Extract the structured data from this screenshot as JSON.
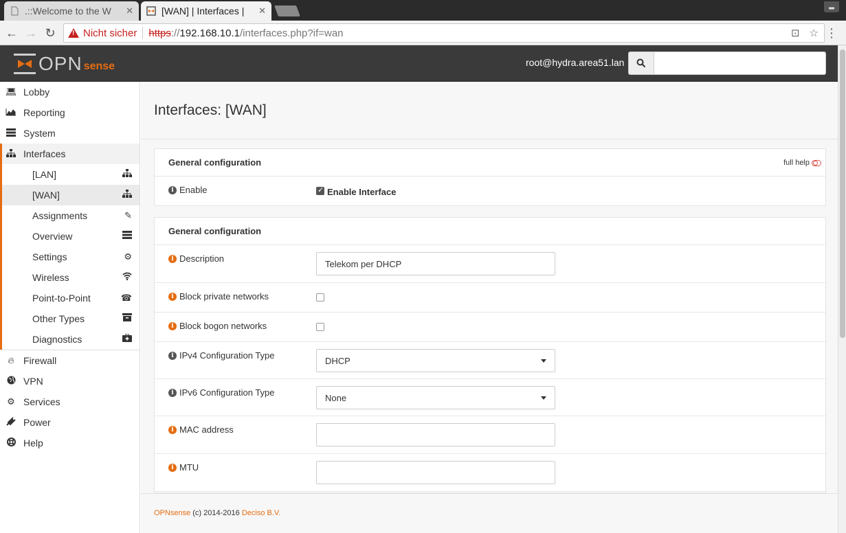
{
  "browser": {
    "tabs": [
      {
        "label": ".::Welcome to the W",
        "close": "✕"
      },
      {
        "label": "[WAN] | Interfaces |",
        "close": "✕"
      }
    ],
    "security_label": "Nicht sicher",
    "url_scheme": "https",
    "url_sep": "://",
    "url_host": "192.168.10.1",
    "url_path": "/interfaces.php?if=wan"
  },
  "header": {
    "logo_opn": "OPN",
    "logo_sense": "sense",
    "user": "root@hydra.area51.lan",
    "search_placeholder": ""
  },
  "sidebar": {
    "items": [
      {
        "label": "Lobby",
        "icon": "laptop-icon"
      },
      {
        "label": "Reporting",
        "icon": "area-chart-icon"
      },
      {
        "label": "System",
        "icon": "server-icon"
      },
      {
        "label": "Interfaces",
        "icon": "sitemap-icon"
      }
    ],
    "interfaces_sub": [
      {
        "label": "[LAN]",
        "icon": "sitemap-icon"
      },
      {
        "label": "[WAN]",
        "icon": "sitemap-icon"
      },
      {
        "label": "Assignments",
        "icon": "pencil-icon"
      },
      {
        "label": "Overview",
        "icon": "list-icon"
      },
      {
        "label": "Settings",
        "icon": "cogs-icon"
      },
      {
        "label": "Wireless",
        "icon": "wifi-icon"
      },
      {
        "label": "Point-to-Point",
        "icon": "phone-icon"
      },
      {
        "label": "Other Types",
        "icon": "archive-icon"
      },
      {
        "label": "Diagnostics",
        "icon": "medkit-icon"
      }
    ],
    "bottom_items": [
      {
        "label": "Firewall",
        "icon": "fire-icon"
      },
      {
        "label": "VPN",
        "icon": "globe-icon"
      },
      {
        "label": "Services",
        "icon": "cog-icon"
      },
      {
        "label": "Power",
        "icon": "plug-icon"
      },
      {
        "label": "Help",
        "icon": "lifebuoy-icon"
      }
    ]
  },
  "page": {
    "title": "Interfaces: [WAN]",
    "box1": {
      "heading": "General configuration",
      "full_help": "full help",
      "enable_label": "Enable",
      "enable_checkbox_label": "Enable Interface",
      "enabled": true
    },
    "box2": {
      "heading": "General configuration",
      "description_label": "Description",
      "description_value": "Telekom per DHCP",
      "block_private_label": "Block private networks",
      "block_bogon_label": "Block bogon networks",
      "ipv4_label": "IPv4 Configuration Type",
      "ipv4_value": "DHCP",
      "ipv6_label": "IPv6 Configuration Type",
      "ipv6_value": "None",
      "mac_label": "MAC address",
      "mac_value": "",
      "mtu_label": "MTU",
      "mtu_value": ""
    }
  },
  "footer": {
    "brand": "OPNsense",
    "copyright": " (c) 2014-2016 ",
    "company": "Deciso B.V."
  },
  "colors": {
    "accent": "#e56d12",
    "header_bg": "#3a3a3a"
  }
}
